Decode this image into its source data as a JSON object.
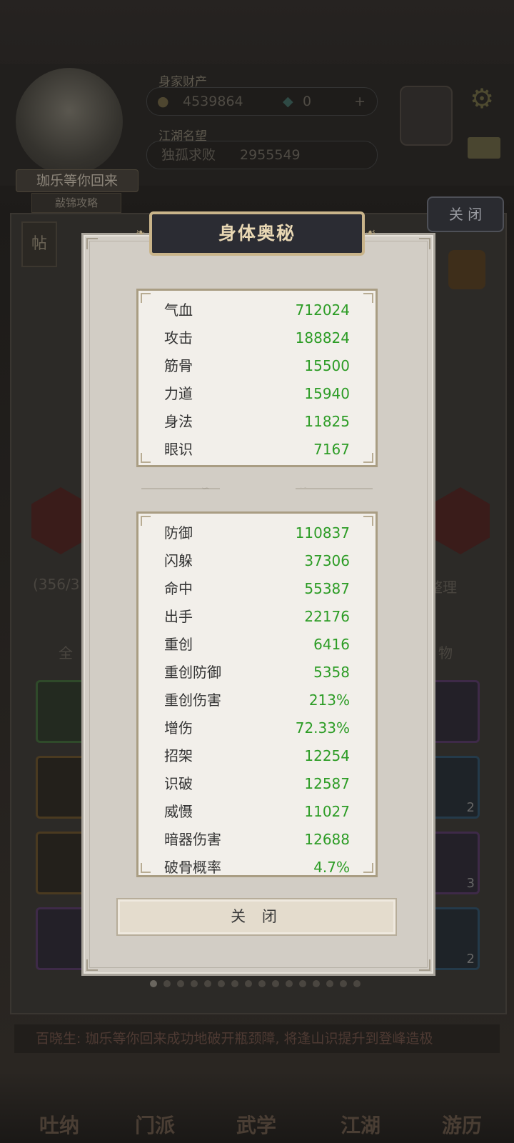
{
  "background": {
    "player_name": "珈乐等你回来",
    "player_sub": "敲锦攻略",
    "assets_label": "身家财产",
    "silver": "4539864",
    "jade": "0",
    "fame_label": "江湖名望",
    "title": "独孤求败",
    "fame_value": "2955549",
    "close_label": "关 闭",
    "tie_label": "帖",
    "bag_count": "(356/3",
    "sort_label": "整理",
    "filter_all": "全",
    "filter_item": "物",
    "slot_counts": [
      "2",
      "3",
      "2"
    ],
    "news": "百晓生: 珈乐等你回来成功地破开瓶颈障, 将逢山识提升到登峰造极",
    "nav": [
      "吐纳",
      "门派",
      "武学",
      "江湖",
      "游历"
    ]
  },
  "modal": {
    "title": "身体奥秘",
    "base_stats": [
      {
        "label": "气血",
        "value": "712024"
      },
      {
        "label": "攻击",
        "value": "188824"
      },
      {
        "label": "筋骨",
        "value": "15500"
      },
      {
        "label": "力道",
        "value": "15940"
      },
      {
        "label": "身法",
        "value": "11825"
      },
      {
        "label": "眼识",
        "value": "7167"
      }
    ],
    "combat_stats": [
      {
        "label": "防御",
        "value": "110837"
      },
      {
        "label": "闪躲",
        "value": "37306"
      },
      {
        "label": "命中",
        "value": "55387"
      },
      {
        "label": "出手",
        "value": "22176"
      },
      {
        "label": "重创",
        "value": "6416"
      },
      {
        "label": "重创防御",
        "value": "5358"
      },
      {
        "label": "重创伤害",
        "value": "213%"
      },
      {
        "label": "增伤",
        "value": "72.33%"
      },
      {
        "label": "招架",
        "value": "12254"
      },
      {
        "label": "识破",
        "value": "12587"
      },
      {
        "label": "威慑",
        "value": "11027"
      },
      {
        "label": "暗器伤害",
        "value": "12688"
      },
      {
        "label": "破骨概率",
        "value": "4.7%"
      }
    ],
    "close_button": "关 闭"
  }
}
